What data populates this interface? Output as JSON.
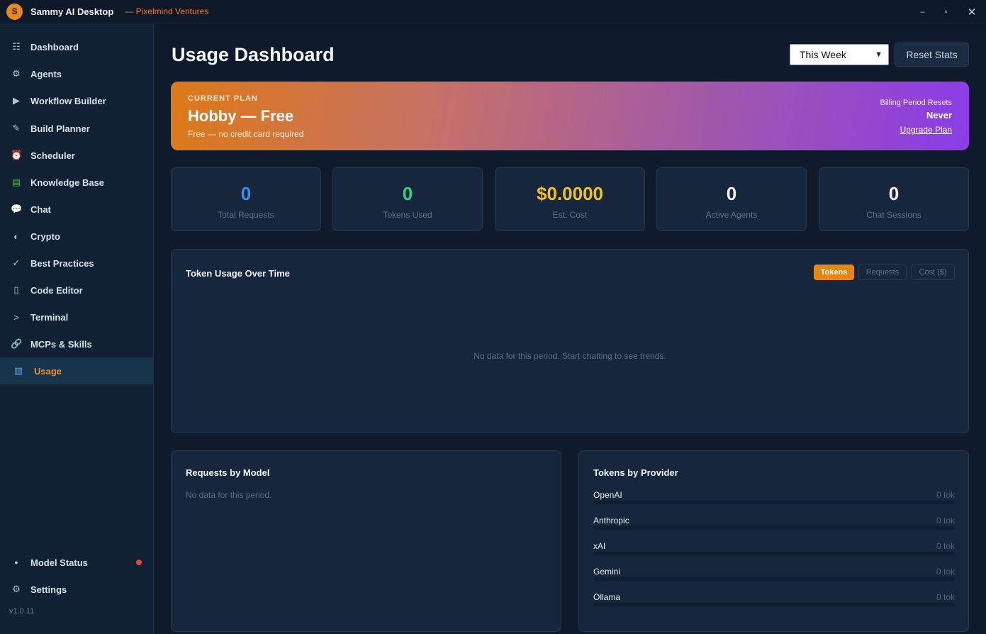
{
  "titlebar": {
    "logo_letter": "S",
    "app_name": "Sammy AI Desktop",
    "org": "— Pixelmind Ventures",
    "minimize": "–",
    "maximize": "▫",
    "close": "✕"
  },
  "sidebar": {
    "items": [
      {
        "label": "Dashboard",
        "icon": "☷",
        "icon_name": "grid-icon"
      },
      {
        "label": "Agents",
        "icon": "⚙",
        "icon_name": "gear-icon"
      },
      {
        "label": "Workflow Builder",
        "icon": "▶",
        "icon_name": "play-icon"
      },
      {
        "label": "Build Planner",
        "icon": "✎",
        "icon_name": "pencil-icon"
      },
      {
        "label": "Scheduler",
        "icon": "⏰",
        "icon_name": "alarm-clock-icon"
      },
      {
        "label": "Knowledge Base",
        "icon": "▤",
        "icon_name": "books-icon"
      },
      {
        "label": "Chat",
        "icon": "💬",
        "icon_name": "speech-bubble-icon"
      },
      {
        "label": "Crypto",
        "icon": "◐",
        "icon_name": "coin-icon"
      },
      {
        "label": "Best Practices",
        "icon": "✓",
        "icon_name": "checkmark-icon"
      },
      {
        "label": "Code Editor",
        "icon": "▯",
        "icon_name": "document-icon"
      },
      {
        "label": "Terminal",
        "icon": ">",
        "icon_name": "terminal-icon"
      },
      {
        "label": "MCPs & Skills",
        "icon": "🔗",
        "icon_name": "link-icon"
      },
      {
        "label": "Usage",
        "icon": "▥",
        "icon_name": "bar-chart-icon",
        "active": true
      }
    ],
    "bottom": [
      {
        "label": "Model Status",
        "icon": "●",
        "icon_name": "dot-icon",
        "status_color": "#e84242"
      },
      {
        "label": "Settings",
        "icon": "⚙",
        "icon_name": "gear-icon"
      }
    ],
    "version": "v1.0.11"
  },
  "header": {
    "title": "Usage Dashboard",
    "period_selected": "This Week",
    "reset_label": "Reset Stats"
  },
  "plan": {
    "kicker": "CURRENT PLAN",
    "name": "Hobby — Free",
    "note": "Free — no credit card required",
    "billing_label": "Billing Period Resets",
    "billing_value": "Never",
    "upgrade_label": "Upgrade Plan"
  },
  "stats": [
    {
      "value": "0",
      "label": "Total Requests",
      "color": "#3f8cf0"
    },
    {
      "value": "0",
      "label": "Tokens Used",
      "color": "#2ed37a"
    },
    {
      "value": "$0.0000",
      "label": "Est. Cost",
      "color": "#f3c318"
    },
    {
      "value": "0",
      "label": "Active Agents",
      "color": "#f1f5f9"
    },
    {
      "value": "0",
      "label": "Chat Sessions",
      "color": "#f1f5f9"
    }
  ],
  "token_chart": {
    "title": "Token Usage Over Time",
    "tabs": [
      "Tokens",
      "Requests",
      "Cost ($)"
    ],
    "active_tab": "Tokens",
    "empty_message": "No data for this period. Start chatting to see trends."
  },
  "requests_by_model": {
    "title": "Requests by Model",
    "empty_message": "No data for this period."
  },
  "tokens_by_provider": {
    "title": "Tokens by Provider",
    "providers": [
      {
        "name": "OpenAI",
        "value": "0 tok",
        "fraction": 0
      },
      {
        "name": "Anthropic",
        "value": "0 tok",
        "fraction": 0
      },
      {
        "name": "xAI",
        "value": "0 tok",
        "fraction": 0
      },
      {
        "name": "Gemini",
        "value": "0 tok",
        "fraction": 0
      },
      {
        "name": "Ollama",
        "value": "0 tok",
        "fraction": 0
      }
    ]
  },
  "colors": {
    "accent": "#e8870f",
    "banner_start": "#dd7a17",
    "banner_end": "#8a3ce8"
  }
}
